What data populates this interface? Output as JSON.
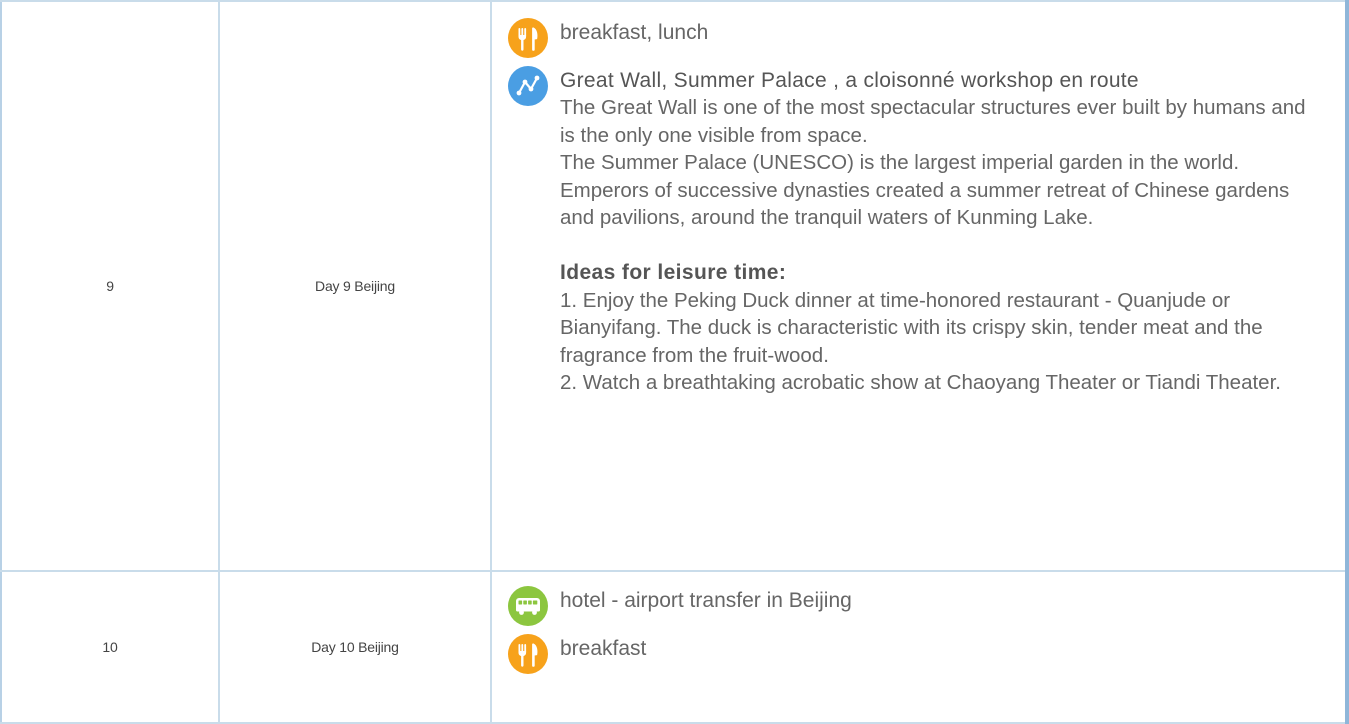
{
  "rows": [
    {
      "number": "9",
      "day": "Day 9 Beijing",
      "meals": "breakfast, lunch",
      "route_title": "Great Wall, Summer Palace , a cloisonné workshop en route",
      "description_1": "The Great Wall is one of the most spectacular structures ever built by humans and is the only one visible from space.",
      "description_2": "The Summer Palace (UNESCO) is the largest imperial garden in the world. Emperors of successive dynasties created a summer retreat of Chinese gardens and pavilions, around the tranquil waters of Kunming Lake.",
      "leisure_heading": "Ideas for leisure time:",
      "leisure_1": "1. Enjoy the Peking Duck dinner at time-honored restaurant - Quanjude or Bianyifang. The duck is characteristic with its crispy skin, tender meat and the fragrance from the fruit-wood.",
      "leisure_2": "2. Watch a breathtaking acrobatic show at Chaoyang Theater or Tiandi Theater."
    },
    {
      "number": "10",
      "day": "Day 10 Beijing",
      "transfer": "hotel - airport transfer in Beijing",
      "meals": "breakfast"
    }
  ],
  "icons": {
    "meal": "fork-knife-icon",
    "route": "route-icon",
    "transfer": "bus-icon"
  },
  "colors": {
    "meal_icon": "#f7a21b",
    "route_icon": "#4a9ee3",
    "bus_icon": "#8cc63f",
    "border": "#c9dcea"
  }
}
